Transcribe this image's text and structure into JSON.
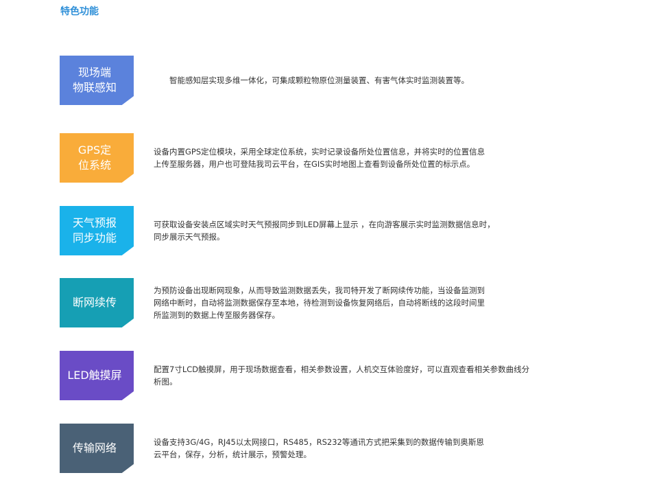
{
  "section_title": "特色功能",
  "features": [
    {
      "title_line1": "现场端",
      "title_line2": "物联感知",
      "color": "#5b82dc",
      "desc_line1": "智能感知层实现多维一体化，可集成颗粒物原位测量装置、有害气体实时监测装置等。",
      "desc_line2": "",
      "desc_line3": ""
    },
    {
      "title_line1": "GPS定",
      "title_line2": "位系统",
      "color": "#f9ac3a",
      "desc_line1": "设备内置GPS定位模块，采用全球定位系统，实时记录设备所处位置信息，并将实时的位置信息",
      "desc_line2": "上传至服务器，用户也可登陆我司云平台，在GIS实时地图上查看到设备所处位置的标示点。",
      "desc_line3": ""
    },
    {
      "title_line1": "天气预报",
      "title_line2": "同步功能",
      "color": "#1ab2ea",
      "desc_line1": "可获取设备安装点区域实时天气预报同步到LED屏幕上显示 ，在向游客展示实时监测数据信息时，",
      "desc_line2": "同步展示天气预报。",
      "desc_line3": ""
    },
    {
      "title_line1": "断网续传",
      "title_line2": "",
      "color": "#169fb4",
      "desc_line1": "为预防设备出现断网现象，从而导致监测数据丢失，我司特开发了断网续传功能，当设备监测到",
      "desc_line2": "网络中断时，自动将监测数据保存至本地，待检测到设备恢复网络后，自动将断线的这段时间里",
      "desc_line3": "所监测到的数据上传至服务器保存。"
    },
    {
      "title_line1": "LED触摸屏",
      "title_line2": "",
      "color": "#6a4cc6",
      "desc_line1": "配置7寸LCD触摸屏，用于现场数据查看，相关参数设置，人机交互体验度好，可以直观查看相关参数曲线分",
      "desc_line2": "析图。",
      "desc_line3": ""
    },
    {
      "title_line1": "传输网络",
      "title_line2": "",
      "color": "#4a6176",
      "desc_line1": "设备支持3G/4G，RJ45以太网接口，RS485，RS232等通讯方式把采集到的数据传输到奥斯恩",
      "desc_line2": "云平台，保存，分析，统计展示，预警处理。",
      "desc_line3": ""
    }
  ]
}
